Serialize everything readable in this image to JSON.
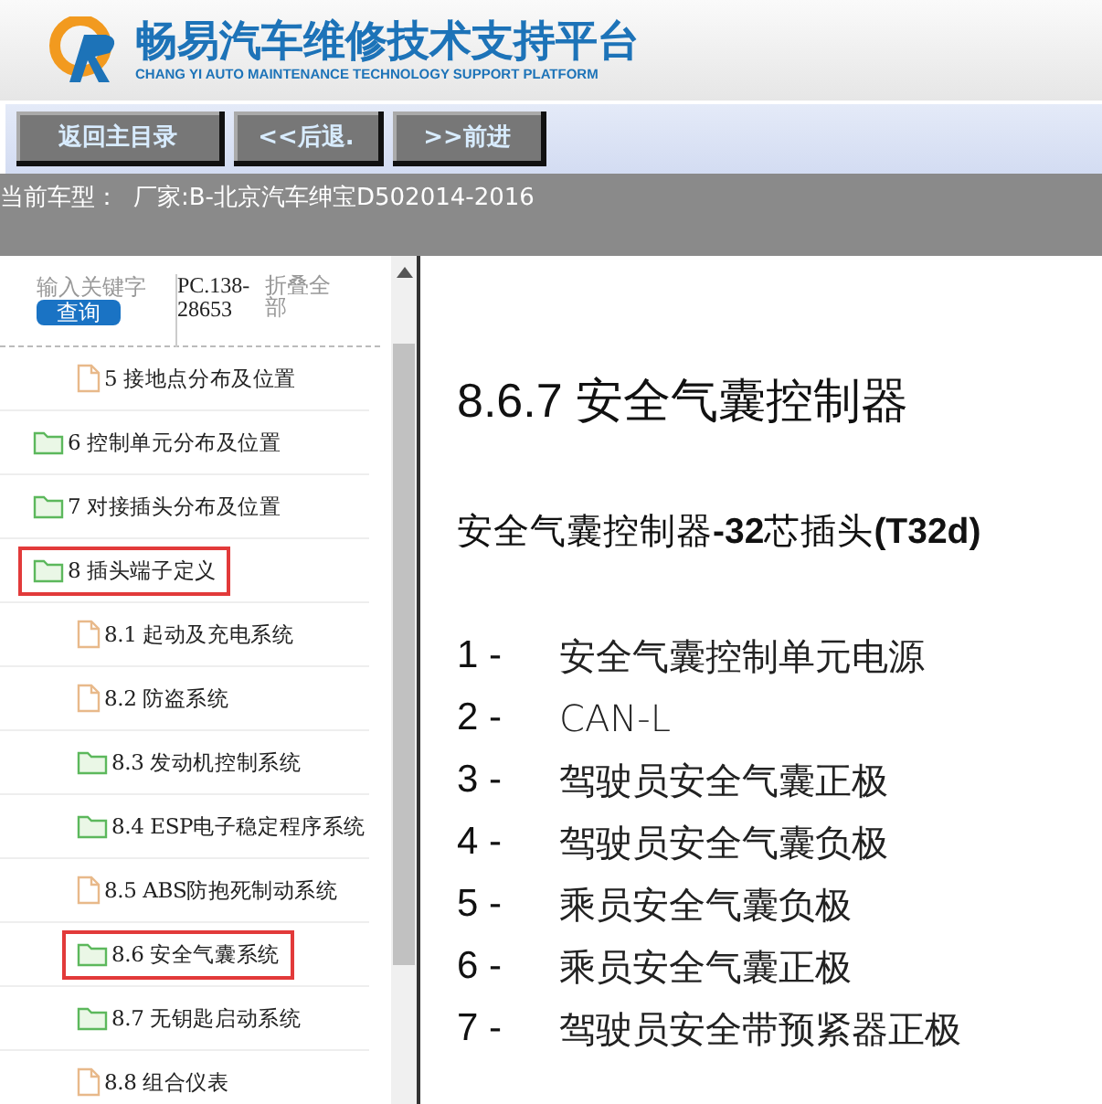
{
  "header": {
    "title": "畅易汽车维修技术支持平台",
    "subtitle": "CHANG YI AUTO MAINTENANCE TECHNOLOGY SUPPORT PLATFORM"
  },
  "toolbar": {
    "buttons": [
      "返回主目录",
      "<<后退.",
      ">>前进"
    ]
  },
  "status_bar": {
    "label": "当前车型：",
    "value": "厂家:B-北京汽车绅宝D502014-2016"
  },
  "search": {
    "placeholder": "输入关键字",
    "button": "查询",
    "code": "PC.138-28653",
    "collapse_all": "折叠全部"
  },
  "tree": {
    "continued_children": [
      {
        "label": "5  接地点分布及位置",
        "kind": "file",
        "highlighted": false
      }
    ],
    "items": [
      {
        "label": "6  控制单元分布及位置",
        "kind": "folder",
        "highlighted": false
      },
      {
        "label": "7  对接插头分布及位置",
        "kind": "folder",
        "highlighted": false
      },
      {
        "label": "8  插头端子定义",
        "kind": "folder",
        "highlighted": true,
        "children": [
          {
            "label": "8.1  起动及充电系统",
            "kind": "file",
            "highlighted": false
          },
          {
            "label": "8.2  防盗系统",
            "kind": "file",
            "highlighted": false
          },
          {
            "label": "8.3  发动机控制系统",
            "kind": "folder",
            "highlighted": false
          },
          {
            "label": "8.4  ESP电子稳定程序系统",
            "kind": "folder",
            "highlighted": false
          },
          {
            "label": "8.5  ABS防抱死制动系统",
            "kind": "file",
            "highlighted": false
          },
          {
            "label": "8.6  安全气囊系统",
            "kind": "folder",
            "highlighted": true
          },
          {
            "label": "8.7  无钥匙启动系统",
            "kind": "folder",
            "highlighted": false
          },
          {
            "label": "8.8  组合仪表",
            "kind": "file",
            "highlighted": false
          }
        ]
      }
    ]
  },
  "document": {
    "heading": "8.6.7  安全气囊控制器",
    "subheading": "安全气囊控制器**-32**芯插头**(T32d)**",
    "pins": [
      {
        "number": "1 -",
        "label": "安全气囊控制单元电源"
      },
      {
        "number": "2 -",
        "label": "CAN-L"
      },
      {
        "number": "3 -",
        "label": "驾驶员安全气囊正极"
      },
      {
        "number": "4 -",
        "label": "驾驶员安全气囊负极"
      },
      {
        "number": "5 -",
        "label": "乘员安全气囊负极"
      },
      {
        "number": "6 -",
        "label": "乘员安全气囊正极"
      },
      {
        "number": "7 -",
        "label": "驾驶员安全带预紧器正极"
      }
    ]
  }
}
